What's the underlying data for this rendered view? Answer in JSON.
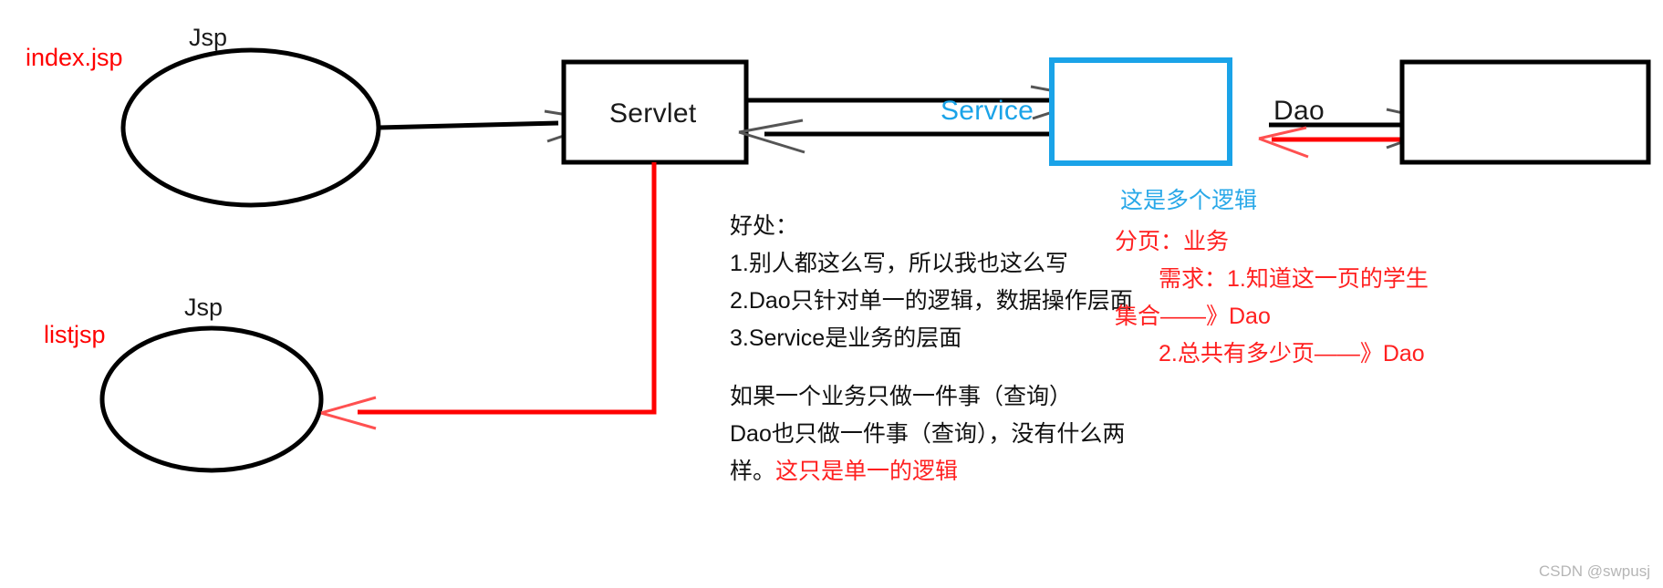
{
  "diagram": {
    "title_watermark": "CSDN @swpusj",
    "nodes": {
      "index_jsp_tag": "index.jsp",
      "index_jsp_caption": "Jsp",
      "list_jsp_tag": "listjsp",
      "list_jsp_caption": "Jsp",
      "servlet": "Servlet",
      "service": "Service",
      "dao": "Dao"
    },
    "colors": {
      "red": "#ff0000",
      "blue": "#1aa3e8",
      "black": "#000000",
      "watermark": "#b6b6b6"
    },
    "notes": {
      "benefits": [
        "好处：",
        "1.别人都这么写，所以我也这么写",
        "2.Dao只针对单一的逻辑，数据操作层面",
        "3.Service是业务的层面"
      ],
      "single_logic": {
        "line1": "如果一个业务只做一件事（查询）",
        "line2": "Dao也只做一件事（查询），没有什么两",
        "line3_black": "样。",
        "line3_red": "这只是单一的逻辑"
      },
      "right_annotations": {
        "blue_line": "这是多个逻辑",
        "red_line1": "分页：业务",
        "red_line2": "需求：1.知道这一页的学生",
        "red_line3": "集合——》Dao",
        "red_line4": "2.总共有多少页——》Dao"
      }
    }
  }
}
